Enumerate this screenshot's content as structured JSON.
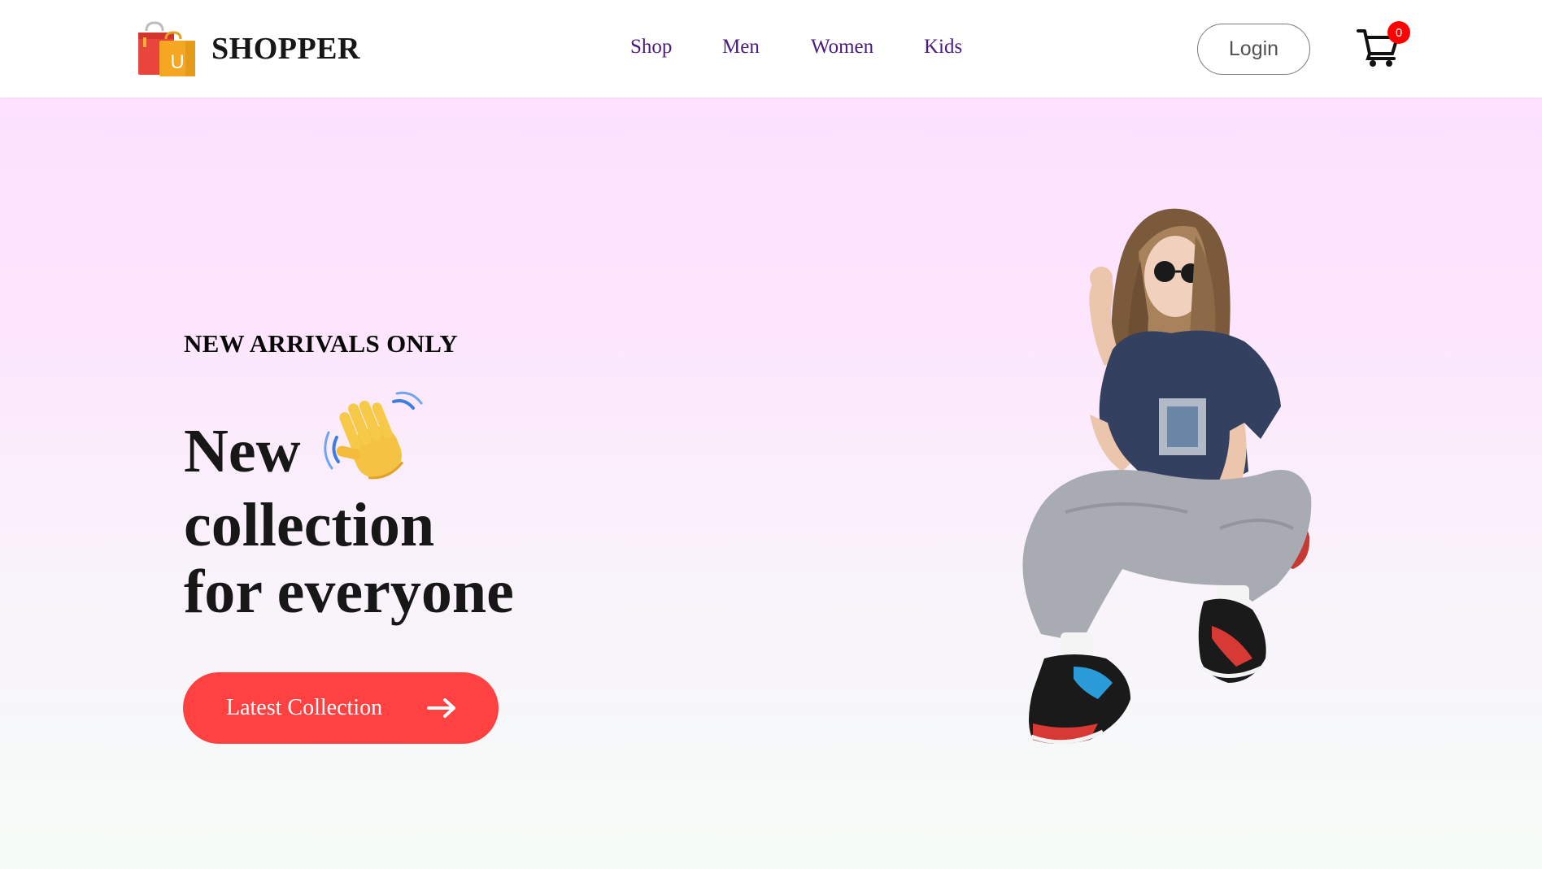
{
  "brand": {
    "name": "SHOPPER",
    "logo_icon": "shopping-bag-icon",
    "colors": {
      "bag_primary": "#e8453c",
      "bag_secondary": "#f5a623"
    }
  },
  "nav": {
    "items": [
      {
        "label": "Shop"
      },
      {
        "label": "Men"
      },
      {
        "label": "Women"
      },
      {
        "label": "Kids"
      }
    ],
    "color": "#4b1a7e"
  },
  "header_actions": {
    "login_label": "Login",
    "cart_icon": "shopping-cart-icon",
    "cart_count": "0",
    "cart_badge_color": "#ff0000"
  },
  "hero": {
    "tagline": "NEW ARRIVALS ONLY",
    "headline_line1": "New",
    "headline_line2": "collection",
    "headline_line3": "for everyone",
    "wave_icon": "waving-hand-icon",
    "cta_label": "Latest Collection",
    "cta_icon": "arrow-right-icon",
    "cta_color": "#ff4141",
    "image": "hero-model-photo",
    "gradient": [
      "#fde1ff",
      "#f5fcf7"
    ]
  }
}
